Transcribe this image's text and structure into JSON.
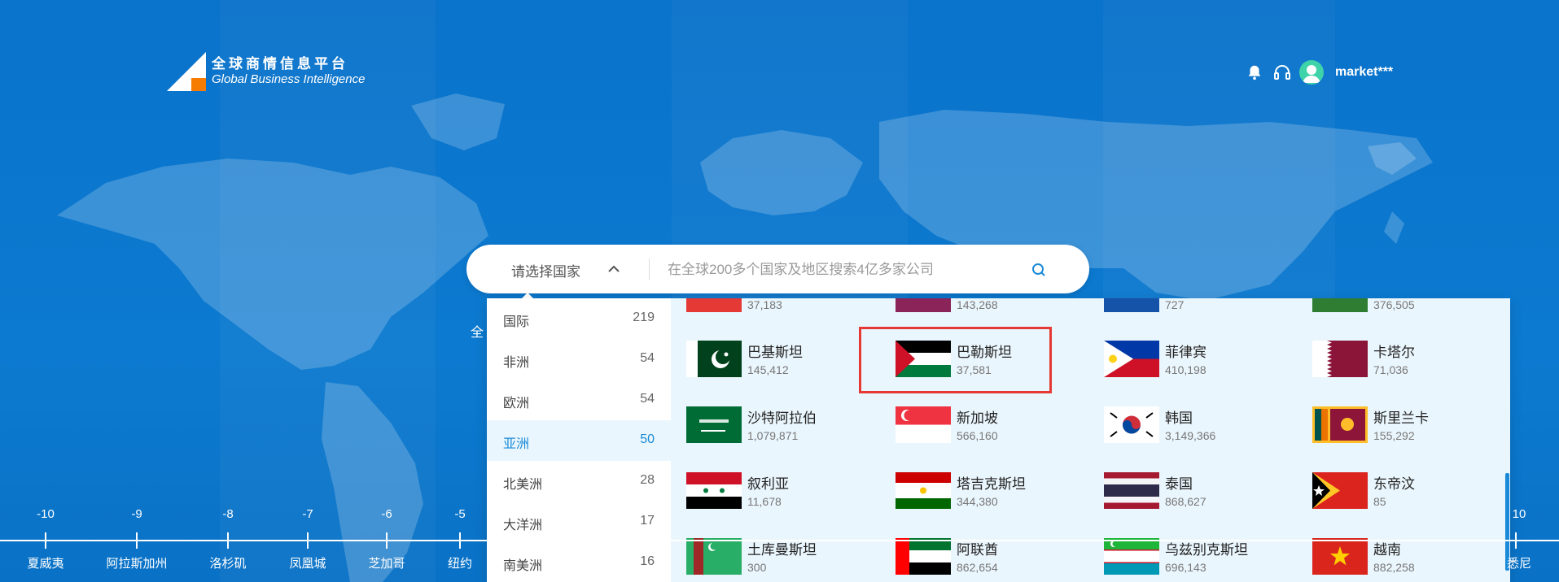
{
  "brand": {
    "title_cn": "全球商情信息平台",
    "title_en": "Global Business Intelligence"
  },
  "header": {
    "username": "market***",
    "icons": [
      "bell-icon",
      "headset-icon",
      "user-avatar"
    ]
  },
  "search": {
    "country_select_label": "请选择国家",
    "placeholder": "在全球200多个国家及地区搜索4亿多家公司"
  },
  "regions": [
    {
      "name": "国际",
      "count": "219"
    },
    {
      "name": "非洲",
      "count": "54"
    },
    {
      "name": "欧洲",
      "count": "54"
    },
    {
      "name": "亚洲",
      "count": "50"
    },
    {
      "name": "北美洲",
      "count": "28"
    },
    {
      "name": "大洋洲",
      "count": "17"
    },
    {
      "name": "南美洲",
      "count": "16"
    }
  ],
  "active_region": "亚洲",
  "top_row_partial": [
    "37,183",
    "143,268",
    "727",
    "376,505"
  ],
  "countries": [
    {
      "name": "巴基斯坦",
      "count": "145,412",
      "flag": "pakistan"
    },
    {
      "name": "巴勒斯坦",
      "count": "37,581",
      "flag": "palestine"
    },
    {
      "name": "菲律宾",
      "count": "410,198",
      "flag": "philippines"
    },
    {
      "name": "卡塔尔",
      "count": "71,036",
      "flag": "qatar"
    },
    {
      "name": "沙特阿拉伯",
      "count": "1,079,871",
      "flag": "saudi-arabia"
    },
    {
      "name": "新加坡",
      "count": "566,160",
      "flag": "singapore"
    },
    {
      "name": "韩国",
      "count": "3,149,366",
      "flag": "south-korea"
    },
    {
      "name": "斯里兰卡",
      "count": "155,292",
      "flag": "sri-lanka"
    },
    {
      "name": "叙利亚",
      "count": "11,678",
      "flag": "syria"
    },
    {
      "name": "塔吉克斯坦",
      "count": "344,380",
      "flag": "tajikistan"
    },
    {
      "name": "泰国",
      "count": "868,627",
      "flag": "thailand"
    },
    {
      "name": "东帝汶",
      "count": "85",
      "flag": "timor-leste"
    },
    {
      "name": "土库曼斯坦",
      "count": "300",
      "flag": "turkmenistan"
    },
    {
      "name": "阿联酋",
      "count": "862,654",
      "flag": "uae"
    },
    {
      "name": "乌兹别克斯坦",
      "count": "696,143",
      "flag": "uzbekistan"
    },
    {
      "name": "越南",
      "count": "882,258",
      "flag": "vietnam"
    }
  ],
  "highlighted_country": "巴勒斯坦",
  "side_text": "全",
  "timeline": {
    "zones": [
      "-10",
      "-9",
      "-8",
      "-7",
      "-6",
      "-5",
      "10"
    ],
    "cities": [
      "夏威夷",
      "阿拉斯加州",
      "洛杉矶",
      "凤凰城",
      "芝加哥",
      "纽约",
      "悉尼"
    ]
  },
  "colors": {
    "background": "#0b74c9",
    "accent": "#1a8ad8",
    "highlight_border": "#e53935",
    "dropdown_bg": "#eaf6fd"
  }
}
